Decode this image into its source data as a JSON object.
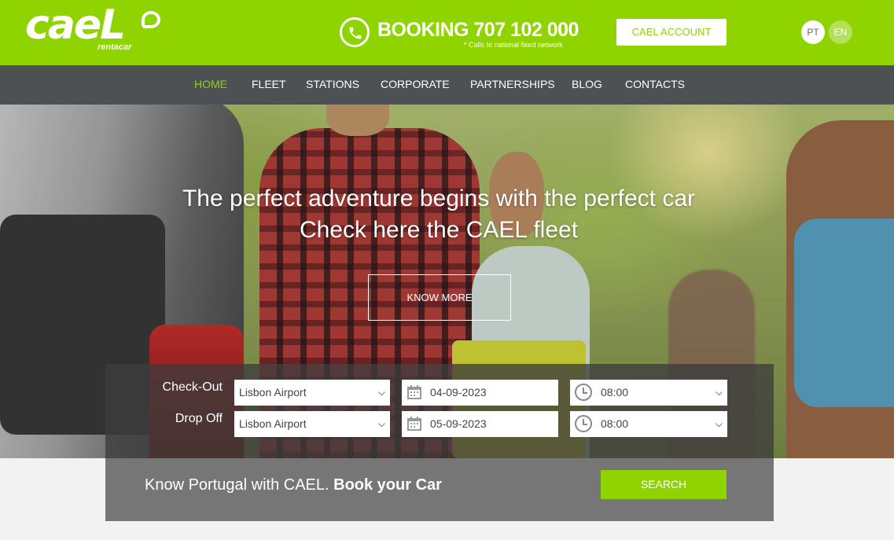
{
  "brand": {
    "logo_text": "caeL",
    "logo_sub": "rentacar"
  },
  "header": {
    "booking_label": "BOOKING 707 102 000",
    "booking_note": "* Calls to national fixed network",
    "account_label": "CAEL ACCOUNT",
    "languages": [
      "PT",
      "EN"
    ]
  },
  "nav": {
    "items": [
      {
        "label": "HOME",
        "active": true
      },
      {
        "label": "FLEET"
      },
      {
        "label": "STATIONS"
      },
      {
        "label": "CORPORATE"
      },
      {
        "label": "PARTNERSHIPS"
      },
      {
        "label": "BLOG"
      },
      {
        "label": "CONTACTS"
      }
    ]
  },
  "hero": {
    "line1": "The perfect adventure begins with the perfect car",
    "line2": "Check here the CAEL fleet",
    "cta": "KNOW MORE"
  },
  "booking": {
    "checkout": {
      "label": "Check-Out",
      "location": "Lisbon Airport",
      "date": "04-09-2023",
      "time": "08:00"
    },
    "dropoff": {
      "label": "Drop Off",
      "location": "Lisbon Airport",
      "date": "05-09-2023",
      "time": "08:00"
    },
    "tagline_start": "Know Portugal with CAEL. ",
    "tagline_bold": "Book your Car",
    "search_label": "SEARCH"
  },
  "colors": {
    "accent": "#8fd400",
    "nav_bg": "#4e5154",
    "panel": "#767676"
  },
  "icons": [
    "phone-icon",
    "calendar-icon",
    "clock-icon",
    "chevron-down-icon"
  ]
}
